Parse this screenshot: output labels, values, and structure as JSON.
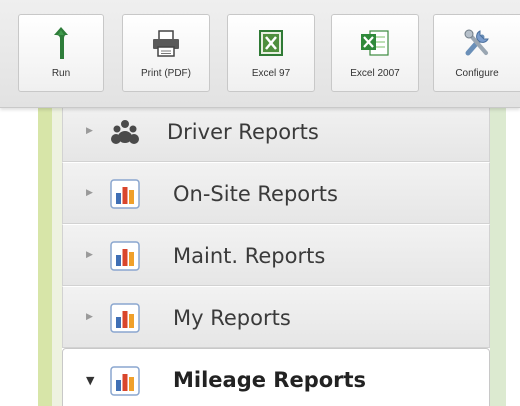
{
  "toolbar": {
    "buttons": [
      {
        "label": "Run",
        "icon": "run-arrow-icon"
      },
      {
        "label": "Print (PDF)",
        "icon": "printer-icon"
      },
      {
        "label": "Excel 97",
        "icon": "excel-97-icon"
      },
      {
        "label": "Excel 2007",
        "icon": "excel-2007-icon"
      },
      {
        "label": "Configure",
        "icon": "tools-icon"
      }
    ]
  },
  "reports": {
    "items": [
      {
        "label": "Driver Reports",
        "icon": "people-group-icon",
        "expanded": false
      },
      {
        "label": "On-Site Reports",
        "icon": "bar-chart-icon",
        "expanded": false
      },
      {
        "label": "Maint. Reports",
        "icon": "bar-chart-icon",
        "expanded": false
      },
      {
        "label": "My Reports",
        "icon": "bar-chart-icon",
        "expanded": false
      },
      {
        "label": "Mileage Reports",
        "icon": "bar-chart-icon",
        "expanded": true
      }
    ]
  },
  "colors": {
    "run_green": "#2e7d3a",
    "excel_green": "#2f7a35",
    "chart_blue": "#3f6fb5",
    "chart_red": "#d9452b",
    "chart_orange": "#f0a02a",
    "sidebar_green": "#d7e5a8"
  }
}
